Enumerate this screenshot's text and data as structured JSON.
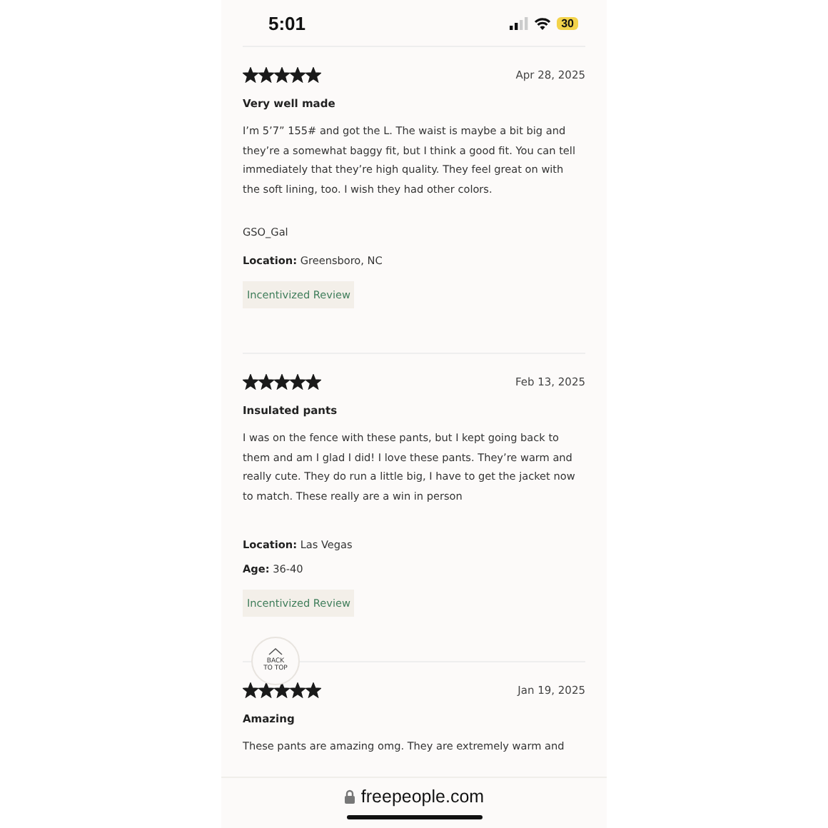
{
  "status_bar": {
    "time": "5:01",
    "battery": "30"
  },
  "reviews": [
    {
      "stars": 5,
      "date": "Apr 28, 2025",
      "title": "Very well made",
      "body": "I’m 5’7” 155# and got the L. The waist is maybe a bit big and they’re a somewhat baggy fit, but I think a good fit. You can tell immediately that they’re high quality. They feel great on with the soft lining, too. I wish they had other colors.",
      "author": "GSO_Gal",
      "details": [
        {
          "label": "Location:",
          "value": "Greensboro, NC"
        }
      ],
      "badge": "Incentivized Review"
    },
    {
      "stars": 5,
      "date": "Feb 13, 2025",
      "title": "Insulated pants",
      "body": "I was on the fence with these pants, but I kept going back to them and am I glad I did! I love these pants. They’re warm and really cute. They do run a little big, I have to get the jacket now to match. These really are a win in person",
      "details": [
        {
          "label": "Location:",
          "value": "Las Vegas"
        },
        {
          "label": "Age:",
          "value": "36-40"
        }
      ],
      "badge": "Incentivized Review"
    },
    {
      "stars": 5,
      "date": "Jan 19, 2025",
      "title": "Amazing",
      "body": "These pants are amazing omg. They are extremely warm and"
    }
  ],
  "back_to_top": "BACK TO TOP",
  "address_bar": {
    "url": "freepeople.com"
  }
}
